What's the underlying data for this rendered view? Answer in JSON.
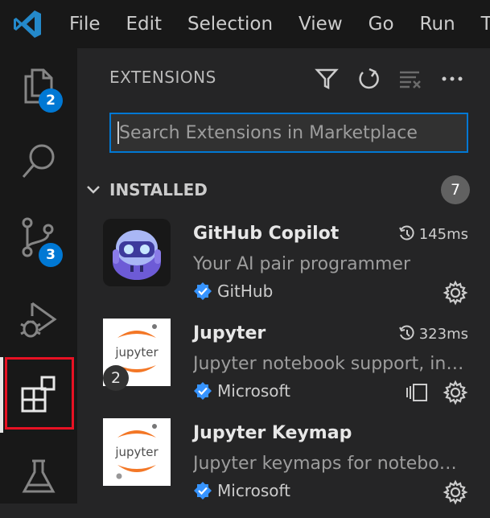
{
  "menubar": {
    "items": [
      "File",
      "Edit",
      "Selection",
      "View",
      "Go",
      "Run",
      "T"
    ]
  },
  "activity_bar": {
    "explorer_badge": "2",
    "source_control_badge": "3"
  },
  "sidebar": {
    "title": "EXTENSIONS",
    "search_placeholder": "Search Extensions in Marketplace",
    "section": {
      "title": "INSTALLED",
      "count": "7"
    },
    "extensions": [
      {
        "name": "GitHub Copilot",
        "time": "145ms",
        "description": "Your AI pair programmer",
        "publisher": "GitHub",
        "icon": "copilot-icon"
      },
      {
        "name": "Jupyter",
        "time": "323ms",
        "description": "Jupyter notebook support, interactive programming and computing",
        "publisher": "Microsoft",
        "icon": "jupyter-icon",
        "badge": "2"
      },
      {
        "name": "Jupyter Keymap",
        "description": "Jupyter keymaps for notebooks",
        "publisher": "Microsoft",
        "icon": "jupyter-icon"
      }
    ]
  },
  "colors": {
    "accent": "#0078d4",
    "highlight_border": "#e81123",
    "background": "#252526",
    "activity_background": "#181818"
  }
}
